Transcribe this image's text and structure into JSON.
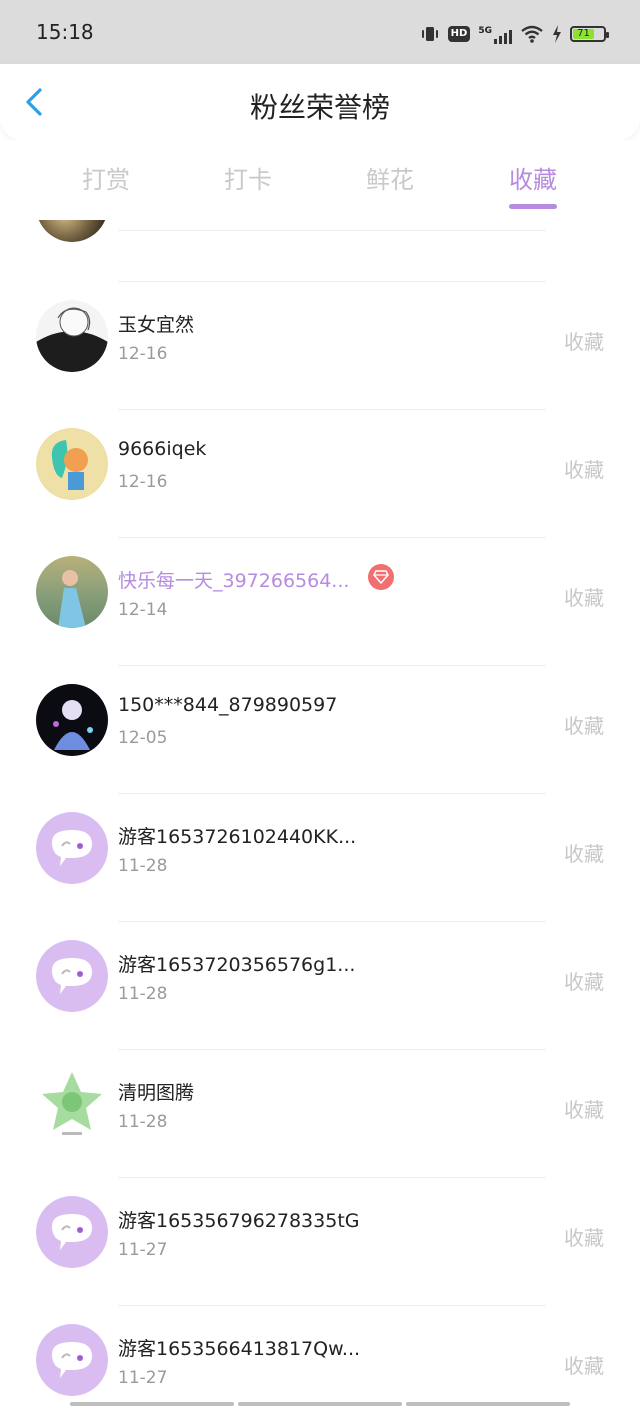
{
  "status_bar": {
    "time": "15:18",
    "signal_label": "5G",
    "hd_label": "HD",
    "battery_level": "71",
    "icons": [
      "vibrate-icon",
      "hd-icon",
      "signal-5g-icon",
      "wifi-icon",
      "charging-icon",
      "battery-icon"
    ]
  },
  "header": {
    "title": "粉丝荣誉榜",
    "back_icon": "chevron-left-icon"
  },
  "tabs": [
    {
      "label": "打赏",
      "active": false
    },
    {
      "label": "打卡",
      "active": false
    },
    {
      "label": "鲜花",
      "active": false
    },
    {
      "label": "收藏",
      "active": true
    }
  ],
  "colors": {
    "accent": "#b68be0",
    "inactive_tab": "#c9c9c9",
    "vip_badge": "#f26f6f",
    "guest_avatar_bg": "#d9bdf0"
  },
  "fans": [
    {
      "name": "玉女宜然",
      "date": "12-16",
      "action": "收藏",
      "avatar": "dark-portrait",
      "vip": false
    },
    {
      "name": "9666iqek",
      "date": "12-16",
      "action": "收藏",
      "avatar": "cartoon-girl",
      "vip": false
    },
    {
      "name": "快乐每一天_397266564...",
      "date": "12-14",
      "action": "收藏",
      "avatar": "girl-in-dress",
      "vip": true
    },
    {
      "name": "150***844_879890597",
      "date": "12-05",
      "action": "收藏",
      "avatar": "anime-dark",
      "vip": false
    },
    {
      "name": "游客1653726102440KK...",
      "date": "11-28",
      "action": "收藏",
      "avatar": "guest-chat",
      "vip": false
    },
    {
      "name": "游客1653720356576g1...",
      "date": "11-28",
      "action": "收藏",
      "avatar": "guest-chat",
      "vip": false
    },
    {
      "name": "清明图腾",
      "date": "11-28",
      "action": "收藏",
      "avatar": "green-emblem",
      "vip": false
    },
    {
      "name": "游客165356796278335tG",
      "date": "11-27",
      "action": "收藏",
      "avatar": "guest-chat",
      "vip": false
    },
    {
      "name": "游客1653566413817Qw...",
      "date": "11-27",
      "action": "收藏",
      "avatar": "guest-chat",
      "vip": false
    }
  ]
}
